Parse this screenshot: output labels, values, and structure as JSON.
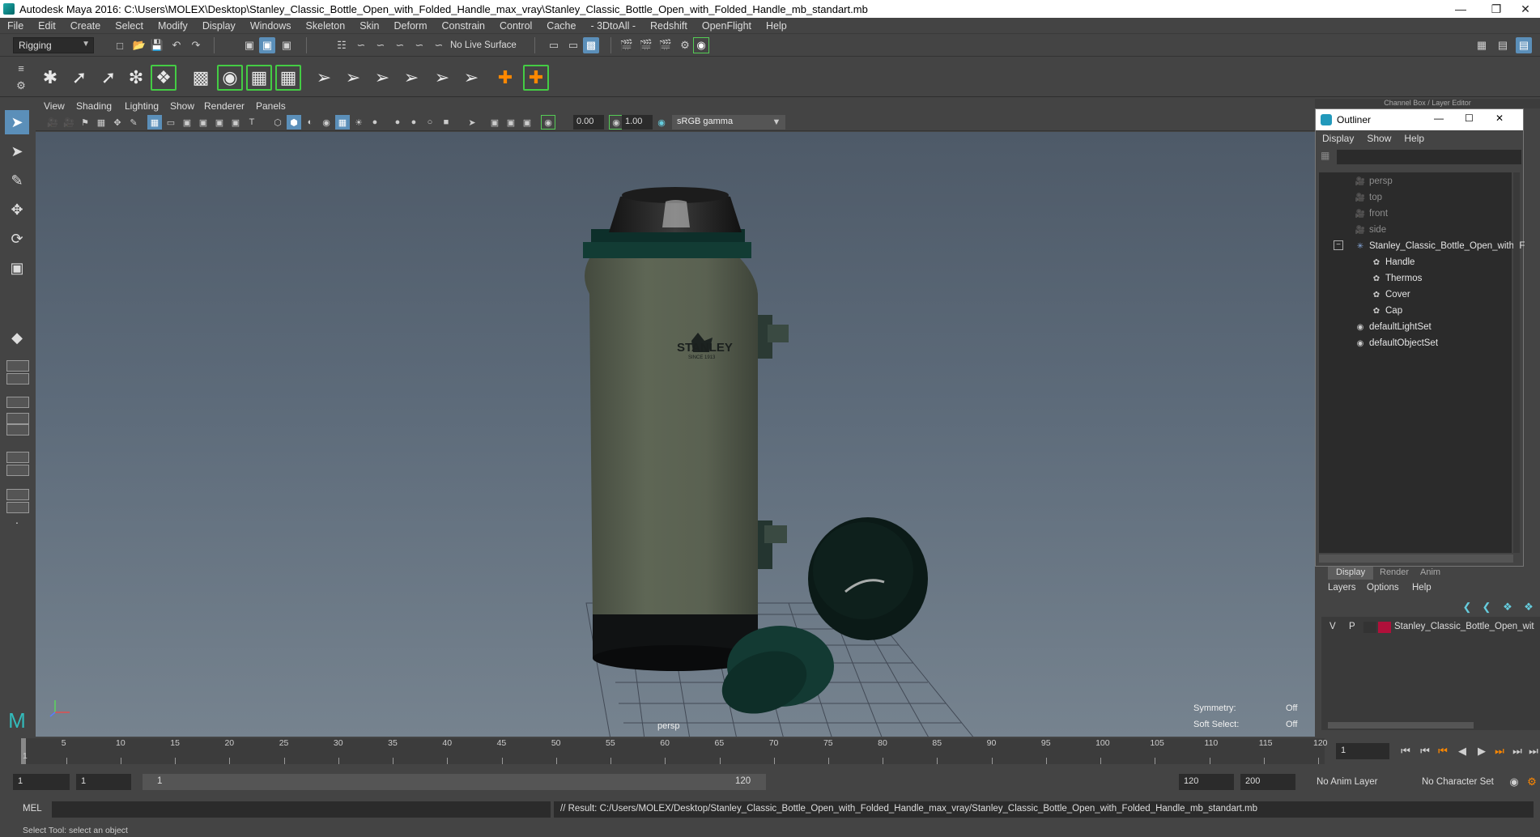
{
  "window": {
    "title": "Autodesk Maya 2016: C:\\Users\\MOLEX\\Desktop\\Stanley_Classic_Bottle_Open_with_Folded_Handle_max_vray\\Stanley_Classic_Bottle_Open_with_Folded_Handle_mb_standart.mb"
  },
  "menubar": [
    "File",
    "Edit",
    "Create",
    "Select",
    "Modify",
    "Display",
    "Windows",
    "Skeleton",
    "Skin",
    "Deform",
    "Constrain",
    "Control",
    "Cache",
    "- 3DtoAll -",
    "Redshift",
    "OpenFlight",
    "Help"
  ],
  "statusline": {
    "mode": "Rigging",
    "live_surface": "No Live Surface"
  },
  "panel": {
    "menus": [
      "View",
      "Shading",
      "Lighting",
      "Show",
      "Renderer",
      "Panels"
    ],
    "exposure": "0.00",
    "gamma_value": "1.00",
    "color_space": "sRGB gamma"
  },
  "viewport": {
    "camera_label": "persp",
    "symmetry_label": "Symmetry:",
    "symmetry_value": "Off",
    "soft_select_label": "Soft Select:",
    "soft_select_value": "Off",
    "brand_text": "STANLEY",
    "brand_sub": "SINCE 1913"
  },
  "right_panel": {
    "header": "Channel Box / Layer Editor",
    "outliner_title": "Outliner",
    "outliner_menu": [
      "Display",
      "Show",
      "Help"
    ],
    "outliner_items": [
      {
        "label": "persp",
        "icon": "camera-icon",
        "indent": 0,
        "dim": true
      },
      {
        "label": "top",
        "icon": "camera-icon",
        "indent": 0,
        "dim": true
      },
      {
        "label": "front",
        "icon": "camera-icon",
        "indent": 0,
        "dim": true
      },
      {
        "label": "side",
        "icon": "camera-icon",
        "indent": 0,
        "dim": true
      },
      {
        "label": "Stanley_Classic_Bottle_Open_with_F",
        "icon": "group-icon",
        "indent": 0,
        "dim": false
      },
      {
        "label": "Handle",
        "icon": "mesh-icon",
        "indent": 1,
        "dim": false
      },
      {
        "label": "Thermos",
        "icon": "mesh-icon",
        "indent": 1,
        "dim": false
      },
      {
        "label": "Cover",
        "icon": "mesh-icon",
        "indent": 1,
        "dim": false
      },
      {
        "label": "Cap",
        "icon": "mesh-icon",
        "indent": 1,
        "dim": false
      },
      {
        "label": "defaultLightSet",
        "icon": "set-icon",
        "indent": 0,
        "dim": false
      },
      {
        "label": "defaultObjectSet",
        "icon": "set-icon",
        "indent": 0,
        "dim": false
      }
    ],
    "layer_tabs": [
      "Display",
      "Render",
      "Anim"
    ],
    "layer_menu": [
      "Layers",
      "Options",
      "Help"
    ],
    "layer_row": {
      "v": "V",
      "p": "P",
      "name": "Stanley_Classic_Bottle_Open_wit",
      "color": "#b0103a"
    }
  },
  "timeline": {
    "ticks": [
      5,
      10,
      15,
      20,
      25,
      30,
      35,
      40,
      45,
      50,
      55,
      60,
      65,
      70,
      75,
      80,
      85,
      90,
      95,
      100,
      105,
      110,
      115,
      120
    ],
    "start_tick": "1",
    "current_frame": "1"
  },
  "range": {
    "start": "1",
    "playback_start": "1",
    "slider_start": "1",
    "slider_end": "120",
    "end": "120",
    "max_end": "200",
    "anim_layer": "No Anim Layer",
    "character_set": "No Character Set"
  },
  "cmdline": {
    "mode": "MEL",
    "result": "// Result: C:/Users/MOLEX/Desktop/Stanley_Classic_Bottle_Open_with_Folded_Handle_max_vray/Stanley_Classic_Bottle_Open_with_Folded_Handle_mb_standart.mb"
  },
  "helpline": "Select Tool: select an object",
  "colors": {
    "accent": "#5b8fb9",
    "thermos_green": "#59604f",
    "cap_dark": "#0c1b17"
  }
}
